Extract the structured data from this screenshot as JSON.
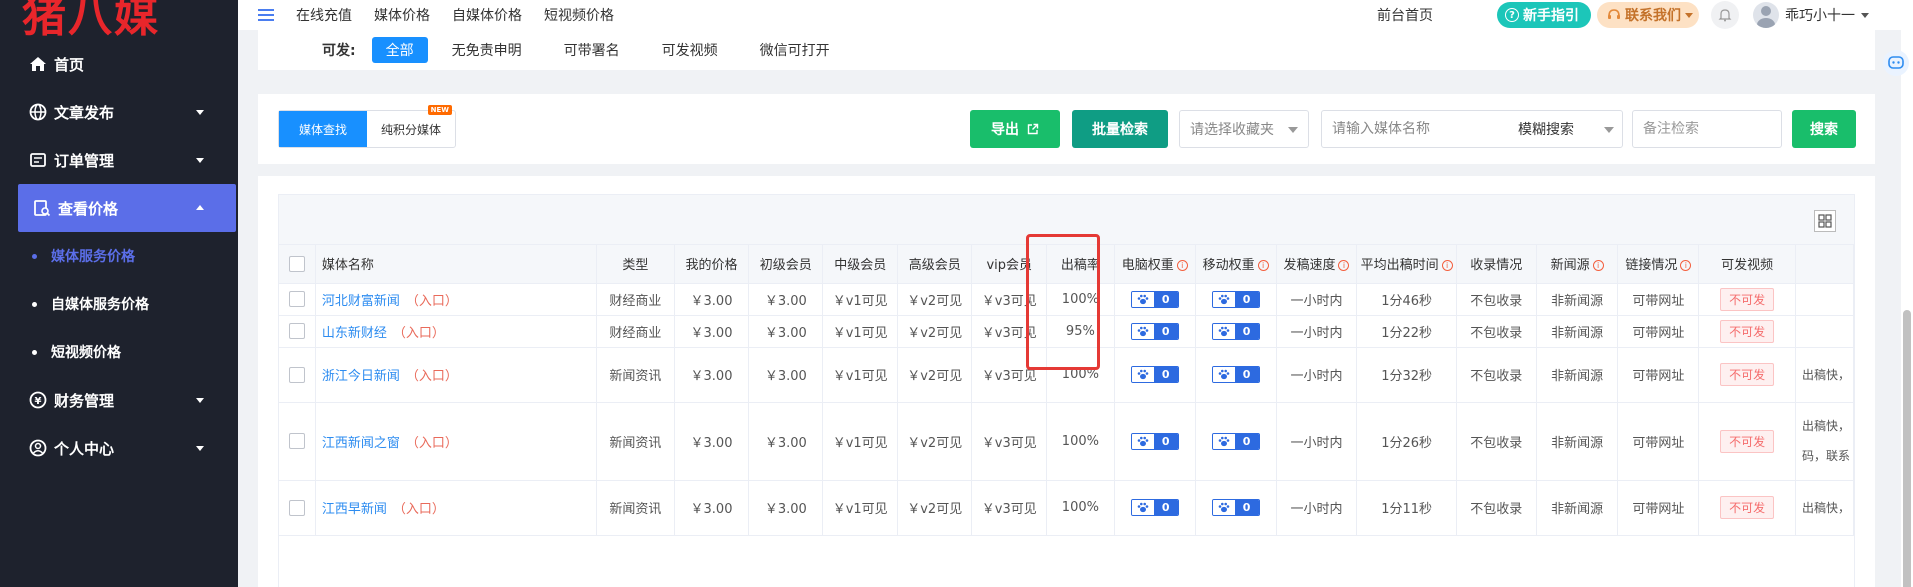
{
  "logo": {
    "text": "猪八媒"
  },
  "sidebar": {
    "items": [
      {
        "label": "首页",
        "icon": "home-icon"
      },
      {
        "label": "文章发布",
        "icon": "globe-icon"
      },
      {
        "label": "订单管理",
        "icon": "ticket-icon"
      },
      {
        "label": "查看价格",
        "icon": "price-search-icon"
      },
      {
        "label": "财务管理",
        "icon": "finance-icon"
      },
      {
        "label": "个人中心",
        "icon": "user-icon"
      }
    ],
    "sub_items": [
      {
        "label": "媒体服务价格"
      },
      {
        "label": "自媒体服务价格"
      },
      {
        "label": "短视频价格"
      }
    ]
  },
  "topbar": {
    "links": [
      "在线充值",
      "媒体价格",
      "自媒体价格",
      "短视频价格"
    ],
    "home": "前台首页",
    "guide": "新手指引",
    "contact": "联系我们",
    "username": "乖巧小十一"
  },
  "filter": {
    "label": "可发:",
    "chips": [
      "全部",
      "无免责申明",
      "可带署名",
      "可发视频",
      "微信可打开"
    ]
  },
  "search": {
    "tab_media": "媒体查找",
    "tab_points": "纯积分媒体",
    "new_badge": "NEW",
    "export": "导出",
    "batch": "批量检索",
    "fav_placeholder": "请选择收藏夹",
    "name_placeholder": "请输入媒体名称",
    "fuzzy": "模糊搜索",
    "remark_placeholder": "备注检索",
    "search_btn": "搜索"
  },
  "table": {
    "headers": [
      "媒体名称",
      "类型",
      "我的价格",
      "初级会员",
      "中级会员",
      "高级会员",
      "vip会员",
      "出稿率",
      "电脑权重",
      "移动权重",
      "发稿速度",
      "平均出稿时间",
      "收录情况",
      "新闻源",
      "链接情况",
      "可发视频",
      ""
    ],
    "entry_label": "（入口）",
    "rows": [
      {
        "name": "河北财富新闻",
        "type": "财经商业",
        "my_price": "￥3.00",
        "junior": "￥3.00",
        "mid": "￥v1可见",
        "senior": "￥v2可见",
        "vip": "￥v3可见",
        "rate": "100%",
        "pc": "0",
        "mobile": "0",
        "speed": "一小时内",
        "avg": "1分46秒",
        "index": "不包收录",
        "news": "非新闻源",
        "link": "可带网址",
        "video": "不可发",
        "remark": ""
      },
      {
        "name": "山东新财经",
        "type": "财经商业",
        "my_price": "￥3.00",
        "junior": "￥3.00",
        "mid": "￥v1可见",
        "senior": "￥v2可见",
        "vip": "￥v3可见",
        "rate": "95%",
        "pc": "0",
        "mobile": "0",
        "speed": "一小时内",
        "avg": "1分22秒",
        "index": "不包收录",
        "news": "非新闻源",
        "link": "可带网址",
        "video": "不可发",
        "remark": ""
      },
      {
        "name": "浙江今日新闻",
        "type": "新闻资讯",
        "my_price": "￥3.00",
        "junior": "￥3.00",
        "mid": "￥v1可见",
        "senior": "￥v2可见",
        "vip": "￥v3可见",
        "rate": "100%",
        "pc": "0",
        "mobile": "0",
        "speed": "一小时内",
        "avg": "1分32秒",
        "index": "不包收录",
        "news": "非新闻源",
        "link": "可带网址",
        "video": "不可发",
        "remark": "出稿快，"
      },
      {
        "name": "江西新闻之窗",
        "type": "新闻资讯",
        "my_price": "￥3.00",
        "junior": "￥3.00",
        "mid": "￥v1可见",
        "senior": "￥v2可见",
        "vip": "￥v3可见",
        "rate": "100%",
        "pc": "0",
        "mobile": "0",
        "speed": "一小时内",
        "avg": "1分26秒",
        "index": "不包收录",
        "news": "非新闻源",
        "link": "可带网址",
        "video": "不可发",
        "remark": "出稿快，码，联系"
      },
      {
        "name": "江西早新闻",
        "type": "新闻资讯",
        "my_price": "￥3.00",
        "junior": "￥3.00",
        "mid": "￥v1可见",
        "senior": "￥v2可见",
        "vip": "￥v3可见",
        "rate": "100%",
        "pc": "0",
        "mobile": "0",
        "speed": "一小时内",
        "avg": "1分11秒",
        "index": "不包收录",
        "news": "非新闻源",
        "link": "可带网址",
        "video": "不可发",
        "remark": "出稿快，"
      }
    ]
  },
  "colors": {
    "sidebar_bg": "#1e222d",
    "active": "#5b6ee8",
    "primary": "#1890ff",
    "green": "#19be6b",
    "teal": "#0f9d84",
    "highlight": "#e53935"
  }
}
